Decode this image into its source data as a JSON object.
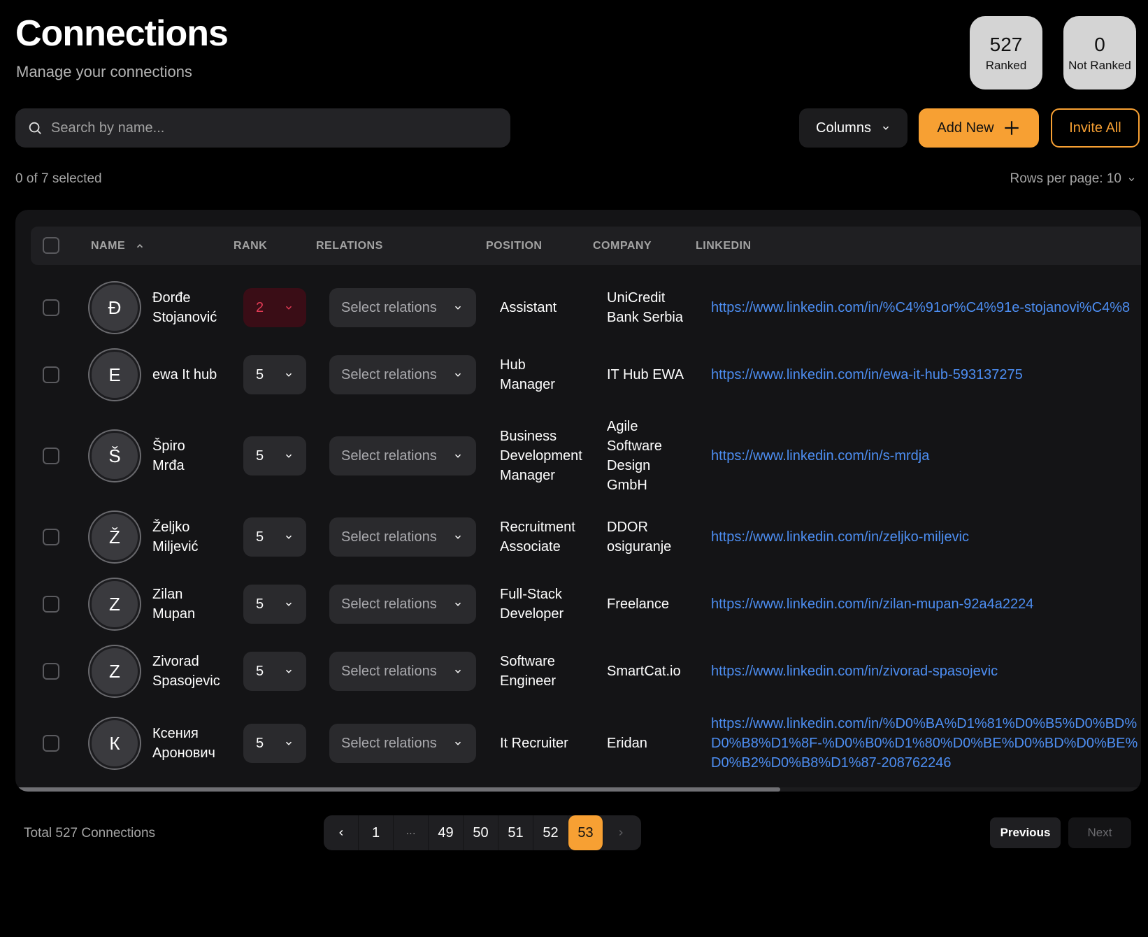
{
  "header": {
    "title": "Connections",
    "subtitle": "Manage your connections"
  },
  "stats": {
    "ranked": {
      "value": "527",
      "label": "Ranked"
    },
    "not_ranked": {
      "value": "0",
      "label": "Not Ranked"
    }
  },
  "search": {
    "placeholder": "Search by name...",
    "value": ""
  },
  "toolbar": {
    "columns_label": "Columns",
    "add_label": "Add New",
    "invite_label": "Invite All"
  },
  "selection": {
    "text": "0 of 7 selected"
  },
  "rows_per_page": {
    "text": "Rows per page: 10"
  },
  "table": {
    "headers": {
      "name": "NAME",
      "rank": "RANK",
      "relations": "RELATIONS",
      "position": "POSITION",
      "company": "COMPANY",
      "linkedin": "LINKEDIN"
    },
    "rows": [
      {
        "initial": "Đ",
        "first": "Đorđe",
        "last": "Stojanović",
        "rank": "2",
        "relations": "Select relations",
        "position": "Assistant",
        "company": "UniCredit Bank Serbia",
        "linkedin": "https://www.linkedin.com/in/%C4%91or%C4%91e-stojanovi%C4%8"
      },
      {
        "initial": "E",
        "first": "ewa It hub",
        "last": "",
        "rank": "5",
        "relations": "Select relations",
        "position": "Hub Manager",
        "company": "IT Hub EWA",
        "linkedin": "https://www.linkedin.com/in/ewa-it-hub-593137275"
      },
      {
        "initial": "Š",
        "first": "Špiro",
        "last": "Mrđa",
        "rank": "5",
        "relations": "Select relations",
        "position": "Business Development Manager",
        "company": "Agile Software Design GmbH",
        "linkedin": "https://www.linkedin.com/in/s-mrdja"
      },
      {
        "initial": "Ž",
        "first": "Željko",
        "last": "Miljević",
        "rank": "5",
        "relations": "Select relations",
        "position": "Recruitment Associate",
        "company": "DDOR osiguranje",
        "linkedin": "https://www.linkedin.com/in/zeljko-miljevic"
      },
      {
        "initial": "Z",
        "first": "Zilan",
        "last": "Mupan",
        "rank": "5",
        "relations": "Select relations",
        "position": "Full-Stack Developer",
        "company": "Freelance",
        "linkedin": "https://www.linkedin.com/in/zilan-mupan-92a4a2224"
      },
      {
        "initial": "Z",
        "first": "Zivorad",
        "last": "Spasojevic",
        "rank": "5",
        "relations": "Select relations",
        "position": "Software Engineer",
        "company": "SmartCat.io",
        "linkedin": "https://www.linkedin.com/in/zivorad-spasojevic"
      },
      {
        "initial": "К",
        "first": "Ксения",
        "last": "Аронович",
        "rank": "5",
        "relations": "Select relations",
        "position": "It Recruiter",
        "company": "Eridan",
        "linkedin": "https://www.linkedin.com/in/%D0%BA%D1%81%D0%B5%D0%BD%D0%B8%D1%8F-%D0%B0%D1%80%D0%BE%D0%BD%D0%BE%D0%B2%D0%B8%D1%87-208762246"
      }
    ]
  },
  "footer": {
    "total": "Total 527 Connections",
    "pages": [
      "1",
      "···",
      "49",
      "50",
      "51",
      "52",
      "53"
    ],
    "active_page": "53",
    "previous_label": "Previous",
    "next_label": "Next"
  },
  "colors": {
    "accent": "#f7a033",
    "link": "#4d8ef2",
    "danger": "#e23b55"
  }
}
